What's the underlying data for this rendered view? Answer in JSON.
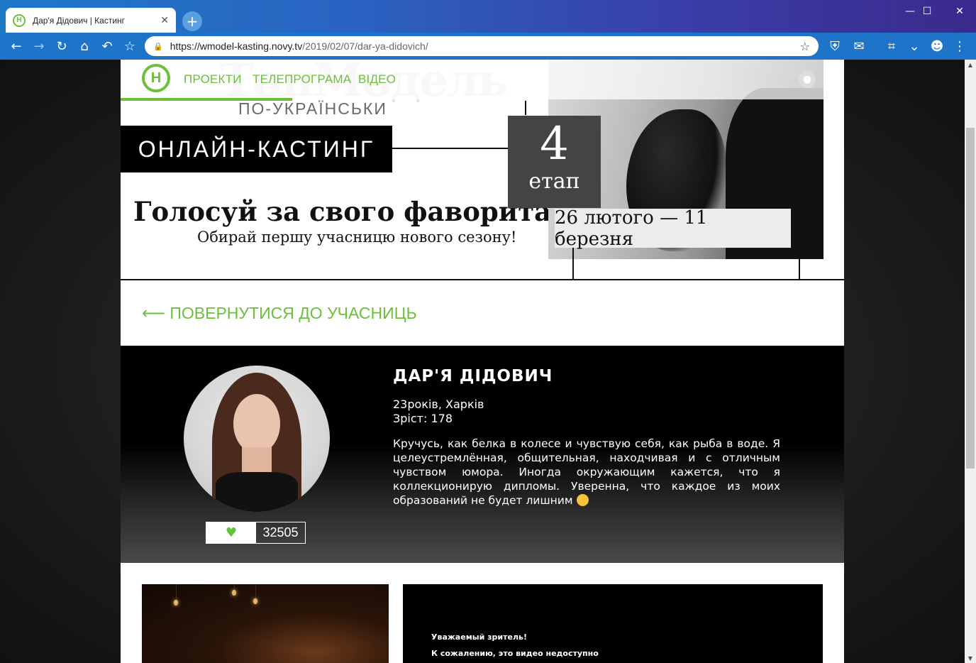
{
  "browser": {
    "tab_title": "Дар'я Дідович | Кастинг",
    "tab_favicon": "Н",
    "url_host": "https://wmodel-kasting.novy.tv",
    "url_path": "/2019/02/07/dar-ya-didovich/"
  },
  "site": {
    "logo_letter": "Н",
    "nav": [
      "ПРОЕКТИ",
      "ТЕЛЕПРОГРАМА",
      "ВІДЕО"
    ],
    "brand_ghost": "ТопМодель",
    "brand_sub": "ПО-УКРАЇНСЬКИ",
    "accent_color": "#6bbf3a"
  },
  "hero": {
    "casting_label": "ОНЛАЙН-КАСТИНГ",
    "stage_number": "4",
    "stage_word": "етап",
    "dates": "26 лютого — 11 березня",
    "vote_title": "Голосуй за свого фаворита!",
    "vote_subtitle": "Обирай першу учасницю нового сезону!"
  },
  "back_link": "⟵ ПОВЕРНУТИСЯ ДО УЧАСНИЦЬ",
  "participant": {
    "name": "ДАР'Я ДІДОВИЧ",
    "age_city": "23років, Харків",
    "height": "Зріст: 178",
    "bio": "Кручусь, как белка в колесе и чувствую себя, как рыба в воде. Я целеустремлённая, общительная, находчивая и с отличным чувством юмора. Иногда окружающим кажется, что я коллекционирую дипломы. Уверенна, что каждое из моих образований не будет лишним",
    "votes": "32505"
  },
  "video": {
    "line1": "Уважаемый зритель!",
    "line2": "К сожалению, это видео недоступно"
  }
}
